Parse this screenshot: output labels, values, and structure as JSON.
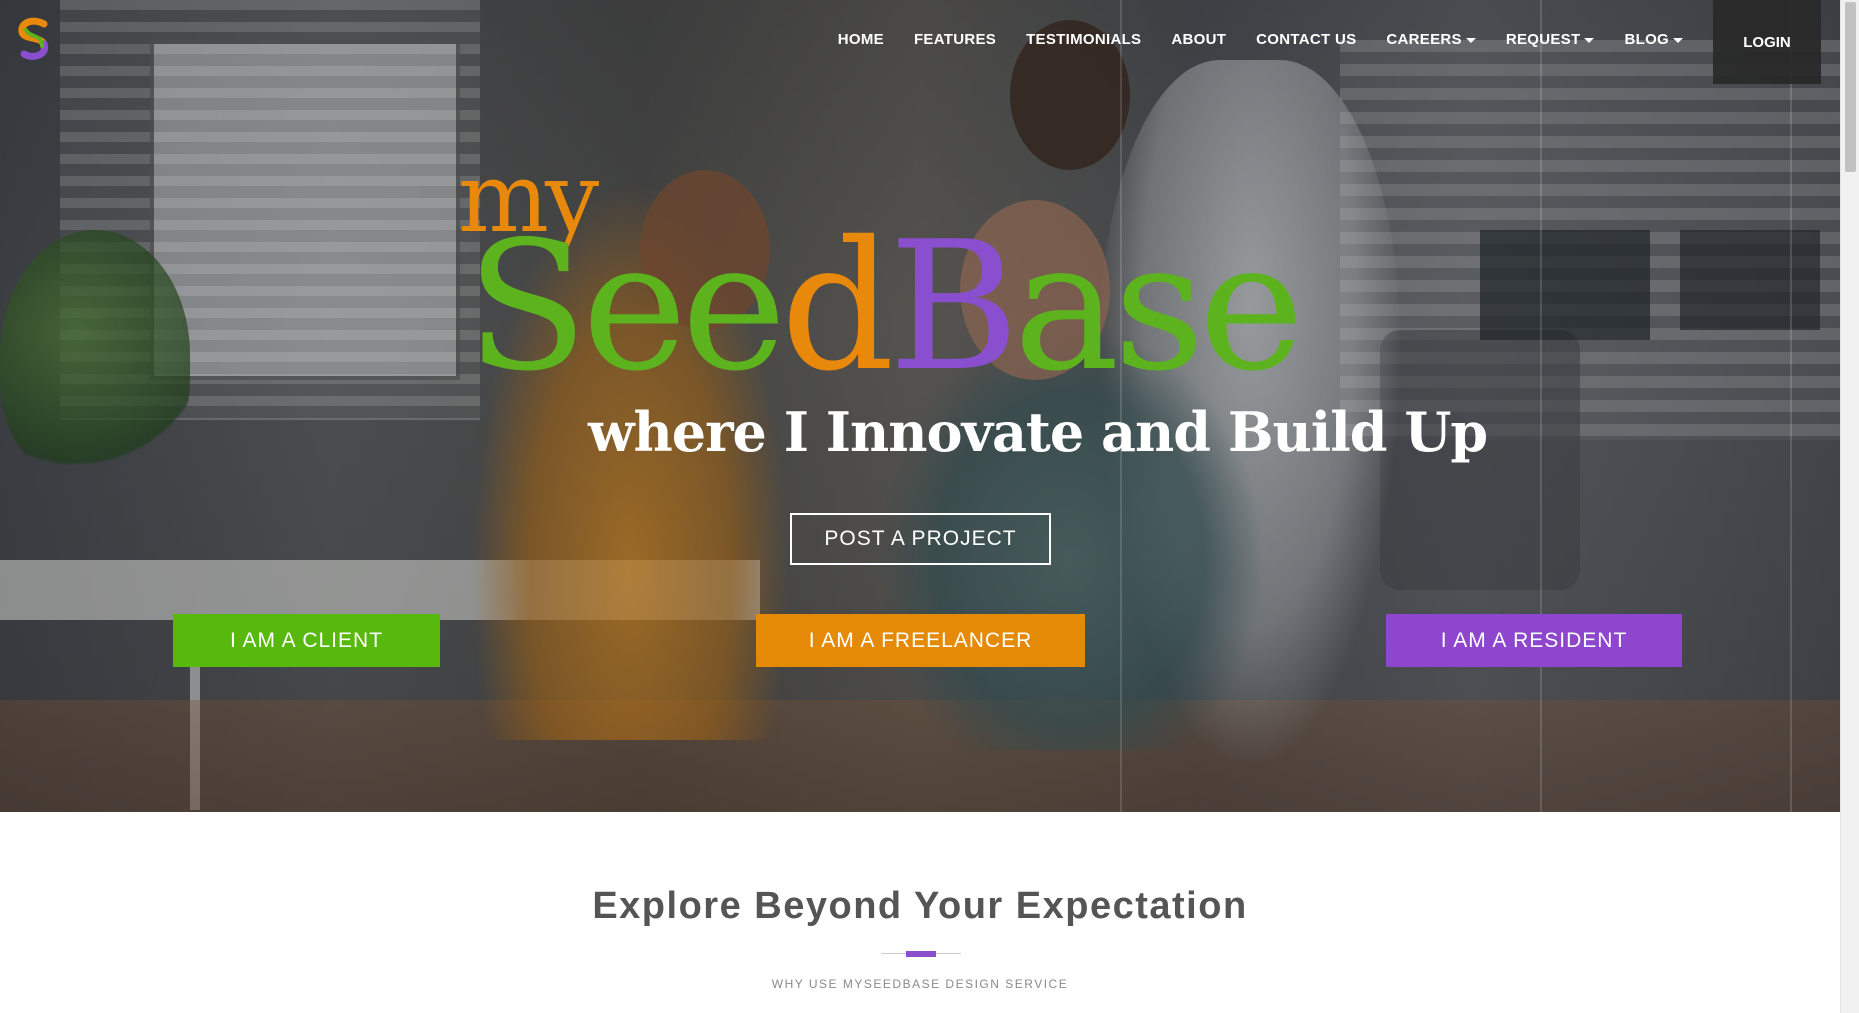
{
  "nav": {
    "home": "HOME",
    "features": "FEATURES",
    "testimonials": "TESTIMONIALS",
    "about": "ABOUT",
    "contact": "CONTACT US",
    "careers": "CAREERS",
    "request": "REQUEST",
    "blog": "BLOG",
    "login": "LOGIN"
  },
  "brand": {
    "my": "my",
    "seed_s": "S",
    "seed_ee": "ee",
    "seed_d": "d",
    "base_b": "B",
    "base_ase": "ase"
  },
  "hero": {
    "tagline": "where I Innovate and Build Up",
    "post_project": "POST A PROJECT",
    "client": "I AM A CLIENT",
    "freelancer": "I AM A FREELANCER",
    "resident": "I AM A RESIDENT"
  },
  "explore": {
    "title": "Explore Beyond Your Expectation",
    "subtitle": "WHY USE MYSEEDBASE DESIGN SERVICE"
  },
  "colors": {
    "green": "#57b80d",
    "orange": "#e48a06",
    "purple": "#8d46cd"
  },
  "icons": {
    "logo": "seedbase-s-logo-icon",
    "dropdown": "caret-down-icon"
  }
}
